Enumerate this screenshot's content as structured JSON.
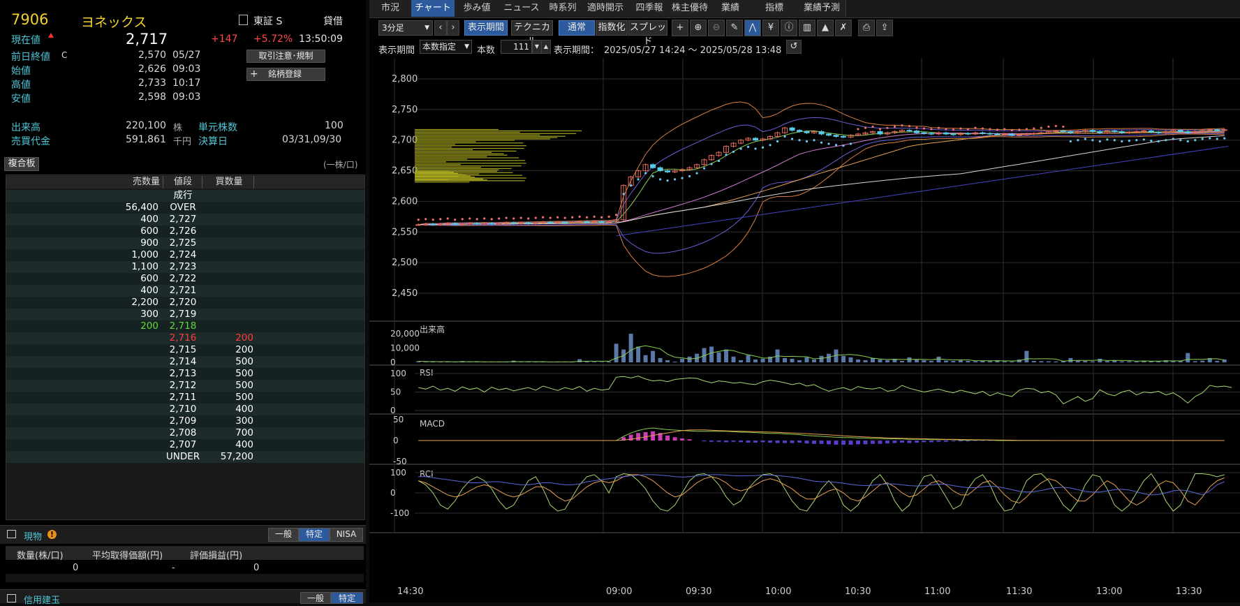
{
  "stock": {
    "code": "7906",
    "name": "ヨネックス",
    "market": "東証 S",
    "margin_type": "貸借",
    "current_label": "現在値",
    "price": "2,717",
    "change": "+147",
    "change_pct": "+5.72%",
    "time": "13:50:09",
    "rule_button": "取引注意･規制",
    "register_button": "銘柄登録",
    "register_plus": "+",
    "stats": [
      {
        "label": "前日終値",
        "mark": "C",
        "value": "2,570",
        "time": "05/27"
      },
      {
        "label": "始値",
        "mark": "",
        "value": "2,626",
        "time": "09:03"
      },
      {
        "label": "高値",
        "mark": "",
        "value": "2,733",
        "time": "10:17"
      },
      {
        "label": "安値",
        "mark": "",
        "value": "2,598",
        "time": "09:03"
      }
    ],
    "volume_label": "出来高",
    "volume": "220,100",
    "volume_unit": "株",
    "unit_label": "単元株数",
    "unit_value": "100",
    "turnover_label": "売買代金",
    "turnover": "591,861",
    "turnover_unit": "千円",
    "settle_label": "決算日",
    "settle_value": "03/31,09/30"
  },
  "orderbook": {
    "title": "複合板",
    "unit_note": "(一株/口)",
    "headers": [
      "売数量",
      "値段",
      "買数量"
    ],
    "rows": [
      {
        "sell": "",
        "price": "成行",
        "buy": "",
        "style": "white"
      },
      {
        "sell": "56,400",
        "price": "OVER",
        "buy": "",
        "style": "white"
      },
      {
        "sell": "400",
        "price": "2,727",
        "buy": "",
        "style": "white"
      },
      {
        "sell": "600",
        "price": "2,726",
        "buy": "",
        "style": "white"
      },
      {
        "sell": "900",
        "price": "2,725",
        "buy": "",
        "style": "white"
      },
      {
        "sell": "1,000",
        "price": "2,724",
        "buy": "",
        "style": "white"
      },
      {
        "sell": "1,100",
        "price": "2,723",
        "buy": "",
        "style": "white"
      },
      {
        "sell": "600",
        "price": "2,722",
        "buy": "",
        "style": "white"
      },
      {
        "sell": "400",
        "price": "2,721",
        "buy": "",
        "style": "white"
      },
      {
        "sell": "2,200",
        "price": "2,720",
        "buy": "",
        "style": "white"
      },
      {
        "sell": "300",
        "price": "2,719",
        "buy": "",
        "style": "white"
      },
      {
        "sell": "200",
        "price": "2,718",
        "buy": "",
        "style": "green"
      },
      {
        "sell": "",
        "price": "2,716",
        "buy": "200",
        "style": "red"
      },
      {
        "sell": "",
        "price": "2,715",
        "buy": "200",
        "style": "white"
      },
      {
        "sell": "",
        "price": "2,714",
        "buy": "500",
        "style": "white"
      },
      {
        "sell": "",
        "price": "2,713",
        "buy": "500",
        "style": "white"
      },
      {
        "sell": "",
        "price": "2,712",
        "buy": "500",
        "style": "white"
      },
      {
        "sell": "",
        "price": "2,711",
        "buy": "500",
        "style": "white"
      },
      {
        "sell": "",
        "price": "2,710",
        "buy": "400",
        "style": "white"
      },
      {
        "sell": "",
        "price": "2,709",
        "buy": "300",
        "style": "white"
      },
      {
        "sell": "",
        "price": "2,708",
        "buy": "700",
        "style": "white"
      },
      {
        "sell": "",
        "price": "2,707",
        "buy": "400",
        "style": "white"
      },
      {
        "sell": "",
        "price": "UNDER",
        "buy": "57,200",
        "style": "white"
      }
    ]
  },
  "holdings": {
    "title": "現物",
    "tabs": [
      "一般",
      "特定",
      "NISA"
    ],
    "active_tab": 1,
    "headers": [
      "数量(株/口)",
      "平均取得価額(円)",
      "評価損益(円)"
    ],
    "values": [
      "0",
      "-",
      "0"
    ]
  },
  "margin": {
    "title": "信用建玉",
    "tabs": [
      "一般",
      "特定"
    ]
  },
  "chart_tabs": [
    "市況",
    "チャート",
    "歩み値",
    "ニュース",
    "時系列",
    "適時開示",
    "四季報",
    "株主優待",
    "業績",
    "指標",
    "業績予測"
  ],
  "active_chart_tab": 1,
  "toolbar": {
    "interval": "3分足",
    "period_button": "表示期間",
    "technical_button": "テクニカル",
    "normal_button": "通常",
    "index_button": "指数化",
    "spread_button": "スプレッド",
    "period_label": "表示期間",
    "period_mode": "本数指定",
    "count_label": "本数",
    "count_value": "111",
    "range_label": "表示期間：",
    "range_value": "2025/05/27 14:24 〜 2025/05/28 13:48"
  },
  "chart_data": {
    "type": "line",
    "price_ticks": [
      "2,800",
      "2,750",
      "2,700",
      "2,650",
      "2,600",
      "2,550",
      "2,500",
      "2,450"
    ],
    "ylim": [
      2450,
      2800
    ],
    "x_ticks": [
      "14:30",
      "09:00",
      "09:30",
      "10:00",
      "10:30",
      "11:00",
      "11:30",
      "13:00",
      "13:30"
    ],
    "close": [
      2562,
      2563,
      2562,
      2563,
      2564,
      2562,
      2563,
      2564,
      2563,
      2564,
      2563,
      2564,
      2565,
      2564,
      2565,
      2564,
      2565,
      2566,
      2565,
      2566,
      2565,
      2566,
      2567,
      2566,
      2567,
      2566,
      2567,
      2570,
      2626,
      2640,
      2650,
      2660,
      2655,
      2650,
      2648,
      2650,
      2652,
      2655,
      2660,
      2668,
      2675,
      2680,
      2690,
      2695,
      2700,
      2703,
      2700,
      2702,
      2706,
      2712,
      2720,
      2716,
      2714,
      2712,
      2714,
      2710,
      2708,
      2706,
      2705,
      2708,
      2710,
      2712,
      2714,
      2710,
      2712,
      2714,
      2716,
      2715,
      2712,
      2711,
      2710,
      2712,
      2710,
      2709,
      2711,
      2710,
      2712,
      2711,
      2710,
      2709,
      2710,
      2708,
      2709,
      2710,
      2711,
      2712,
      2714,
      2715,
      2714,
      2712,
      2714,
      2716,
      2714,
      2712,
      2715,
      2714,
      2712,
      2713,
      2714,
      2715,
      2713,
      2712,
      2714,
      2716,
      2714,
      2712,
      2714,
      2716,
      2717,
      2716,
      2717
    ],
    "volume_label": "出来高",
    "volume_ticks": [
      "20,000",
      "10,000",
      "0"
    ],
    "volume_max": 20000,
    "volume": [
      800,
      300,
      500,
      200,
      600,
      300,
      900,
      200,
      400,
      200,
      300,
      500,
      200,
      1200,
      200,
      300,
      400,
      300,
      200,
      500,
      300,
      400,
      2200,
      600,
      400,
      300,
      500,
      13000,
      9000,
      20000,
      11000,
      5000,
      8000,
      3000,
      1500,
      500,
      2500,
      4000,
      6000,
      10000,
      11000,
      7000,
      9000,
      4000,
      1500,
      5000,
      2000,
      2500,
      4000,
      9000,
      3000,
      2500,
      1500,
      3500,
      2000,
      4500,
      6000,
      9000,
      4500,
      3500,
      2000,
      1500,
      3000,
      2000,
      1500,
      2500,
      1000,
      3500,
      2000,
      1500,
      1000,
      4000,
      1200,
      1000,
      1500,
      1000,
      800,
      1200,
      900,
      1500,
      700,
      600,
      2000,
      8000,
      1000,
      800,
      700,
      600,
      1000,
      3000,
      1200,
      1000,
      700,
      2500,
      900,
      1500,
      700,
      800,
      600,
      1200,
      900,
      700,
      1500,
      800,
      1000,
      6500,
      800,
      1200,
      3000,
      1000,
      2000
    ],
    "rsi_label": "RSI",
    "rsi_ticks": [
      "100",
      "50",
      "0"
    ],
    "rsi": [
      62,
      58,
      66,
      55,
      60,
      52,
      64,
      57,
      61,
      50,
      63,
      56,
      60,
      53,
      58,
      62,
      55,
      66,
      60,
      54,
      62,
      57,
      65,
      52,
      60,
      55,
      58,
      90,
      92,
      88,
      93,
      85,
      80,
      82,
      78,
      84,
      86,
      88,
      87,
      80,
      75,
      80,
      78,
      74,
      76,
      72,
      70,
      78,
      82,
      79,
      75,
      70,
      74,
      66,
      70,
      60,
      52,
      58,
      62,
      55,
      65,
      60,
      58,
      62,
      52,
      55,
      68,
      60,
      55,
      50,
      54,
      58,
      52,
      48,
      55,
      50,
      45,
      52,
      40,
      48,
      42,
      38,
      55,
      60,
      58,
      48,
      52,
      42,
      18,
      28,
      38,
      25,
      32,
      56,
      45,
      40,
      50,
      55,
      42,
      50,
      48,
      52,
      42,
      48,
      36,
      20,
      38,
      48,
      68,
      64,
      66,
      62
    ],
    "macd_label": "MACD",
    "macd_ticks": [
      "50",
      "0",
      "-50"
    ],
    "macd": [
      0,
      0,
      0,
      0,
      0,
      0,
      0,
      0,
      0,
      0,
      0,
      0,
      0,
      0,
      0,
      0,
      0,
      0,
      0,
      0,
      0,
      0,
      0,
      0,
      0,
      0,
      0,
      0,
      10,
      18,
      24,
      28,
      30,
      28,
      26,
      25,
      24,
      23,
      22,
      22,
      22,
      22,
      22,
      21,
      20,
      20,
      19,
      18,
      17,
      17,
      16,
      15,
      14,
      12,
      11,
      10,
      9,
      8,
      7,
      7,
      6,
      6,
      5,
      5,
      4,
      4,
      4,
      3,
      3,
      3,
      2,
      2,
      2,
      2,
      1,
      1,
      1,
      1,
      1,
      0,
      0,
      0,
      0,
      0,
      0,
      0,
      0,
      0,
      0,
      0,
      0,
      0,
      0,
      0,
      0,
      0,
      0,
      0,
      0,
      0,
      0,
      0,
      0,
      0,
      0,
      0,
      0,
      0,
      0,
      0,
      0
    ],
    "macd_hist": [
      0,
      0,
      0,
      0,
      0,
      0,
      0,
      0,
      0,
      0,
      0,
      0,
      0,
      0,
      0,
      0,
      0,
      0,
      0,
      0,
      0,
      0,
      0,
      0,
      0,
      0,
      0,
      0,
      8,
      14,
      18,
      20,
      22,
      18,
      12,
      8,
      5,
      3,
      0,
      -2,
      -3,
      -3,
      -4,
      -3,
      -4,
      -5,
      -5,
      -4,
      -5,
      -6,
      -6,
      -6,
      -5,
      -7,
      -8,
      -8,
      -9,
      -10,
      -10,
      -10,
      -9,
      -9,
      -8,
      -8,
      -7,
      -6,
      -5,
      -6,
      -5,
      -4,
      -4,
      -3,
      -3,
      -2,
      -2,
      -2,
      -1,
      -1,
      -1,
      0,
      0,
      0,
      0,
      0,
      0,
      0,
      0,
      0,
      0,
      0,
      0,
      0,
      0,
      0,
      0,
      0,
      0,
      0,
      0,
      0,
      0,
      0,
      0,
      0,
      0,
      0,
      0,
      0,
      0,
      0,
      0
    ],
    "rci_label": "RCI",
    "rci_ticks": [
      "100",
      "0",
      "-100"
    ],
    "rci_short": [
      60,
      40,
      0,
      -60,
      -80,
      -40,
      20,
      60,
      80,
      60,
      20,
      -40,
      -80,
      -60,
      0,
      60,
      80,
      20,
      -60,
      -90,
      -80,
      -20,
      40,
      80,
      90,
      60,
      0,
      80,
      95,
      90,
      60,
      20,
      -40,
      -80,
      -90,
      -60,
      0,
      60,
      90,
      95,
      80,
      40,
      -20,
      -60,
      -40,
      20,
      60,
      90,
      95,
      80,
      20,
      -40,
      -80,
      -90,
      -40,
      20,
      60,
      20,
      -60,
      -90,
      -60,
      0,
      60,
      90,
      40,
      -40,
      -90,
      -60,
      20,
      80,
      90,
      40,
      -20,
      -80,
      -60,
      20,
      70,
      90,
      40,
      -40,
      -90,
      -80,
      -20,
      60,
      90,
      95,
      60,
      0,
      -60,
      -90,
      -40,
      40,
      90,
      80,
      20,
      -60,
      -90,
      -60,
      0,
      60,
      95,
      40,
      -40,
      -90,
      -60,
      20,
      95,
      95,
      90,
      80,
      90
    ],
    "rci_mid": [
      60,
      50,
      30,
      10,
      -10,
      -20,
      -10,
      10,
      30,
      40,
      30,
      10,
      -10,
      -20,
      -10,
      10,
      30,
      30,
      10,
      -20,
      -40,
      -30,
      0,
      30,
      50,
      60,
      50,
      60,
      80,
      90,
      90,
      80,
      60,
      30,
      0,
      -20,
      -10,
      20,
      50,
      70,
      80,
      70,
      50,
      20,
      10,
      20,
      40,
      60,
      70,
      60,
      40,
      20,
      -10,
      -30,
      -30,
      -10,
      10,
      20,
      0,
      -30,
      -40,
      -20,
      10,
      40,
      50,
      30,
      0,
      -20,
      -10,
      20,
      50,
      60,
      40,
      10,
      -10,
      -10,
      20,
      50,
      60,
      30,
      -10,
      -40,
      -50,
      -20,
      20,
      50,
      70,
      60,
      30,
      -10,
      -40,
      -40,
      -10,
      30,
      60,
      40,
      0,
      -40,
      -60,
      -40,
      0,
      40,
      60,
      50,
      10,
      -40,
      -60,
      -20,
      30,
      60,
      75
    ],
    "rci_long": [
      80,
      80,
      75,
      70,
      65,
      60,
      55,
      50,
      50,
      52,
      55,
      55,
      50,
      45,
      40,
      40,
      45,
      50,
      50,
      45,
      40,
      40,
      45,
      55,
      60,
      65,
      70,
      75,
      80,
      85,
      88,
      90,
      90,
      88,
      85,
      80,
      78,
      80,
      84,
      88,
      90,
      90,
      88,
      85,
      84,
      85,
      86,
      88,
      88,
      86,
      82,
      78,
      72,
      65,
      58,
      55,
      55,
      52,
      48,
      42,
      38,
      36,
      38,
      42,
      45,
      44,
      40,
      36,
      34,
      36,
      40,
      44,
      42,
      36,
      30,
      26,
      26,
      30,
      34,
      30,
      24,
      16,
      8,
      4,
      6,
      12,
      20,
      26,
      28,
      24,
      16,
      8,
      4,
      4,
      10,
      16,
      18,
      14,
      6,
      -4,
      -10,
      -8,
      0,
      10,
      14,
      10,
      0,
      -10,
      10,
      40,
      55
    ]
  }
}
